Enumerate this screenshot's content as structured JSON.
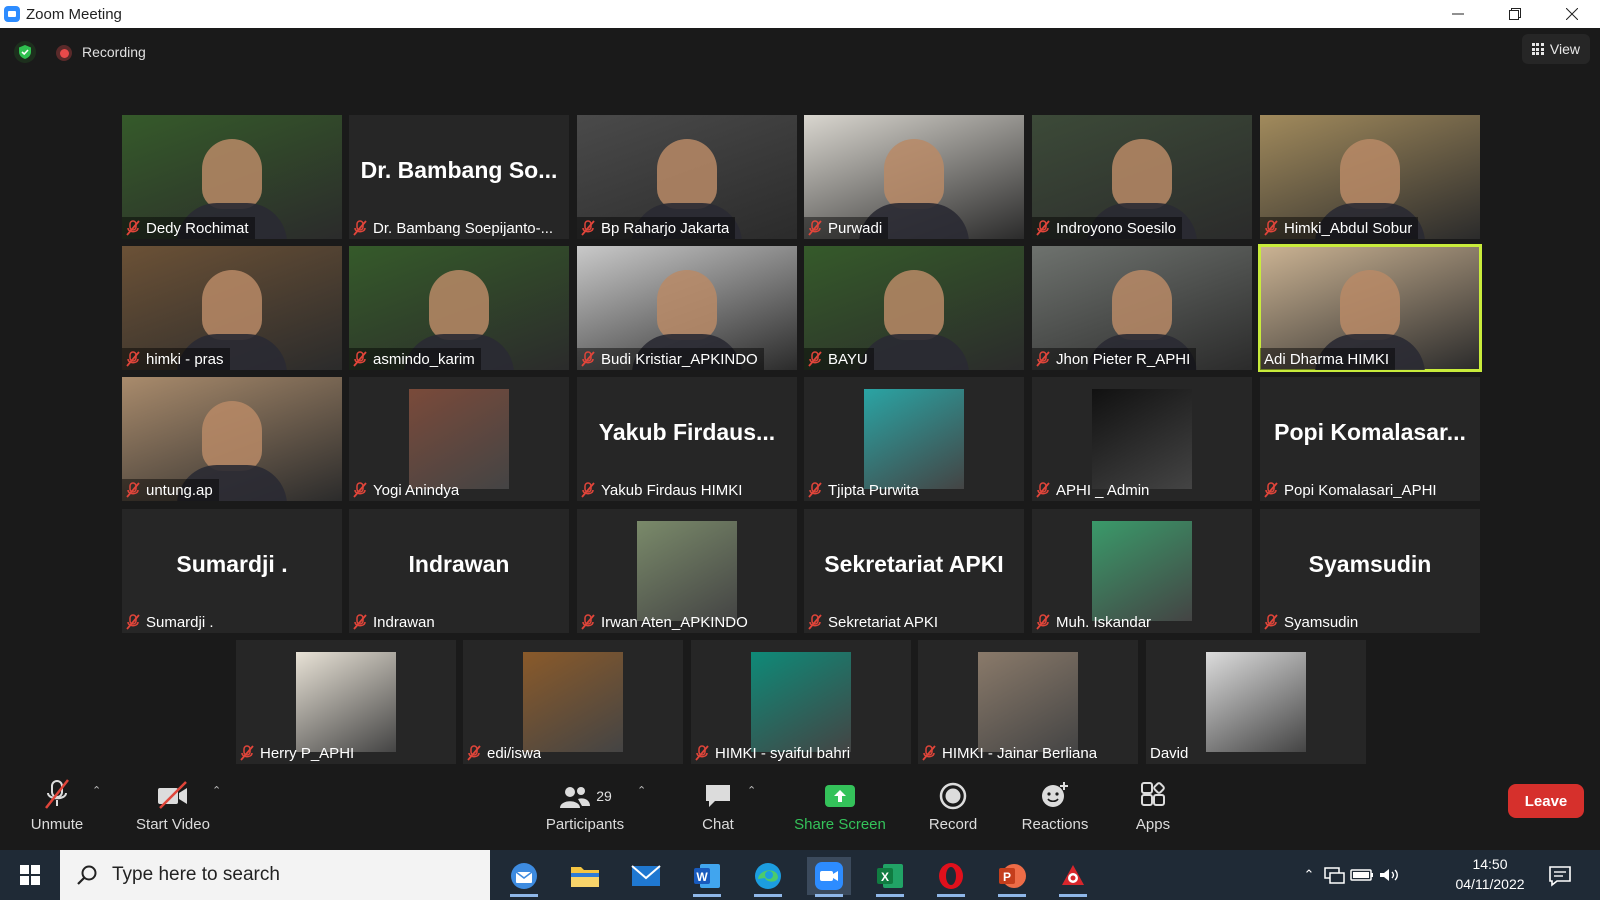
{
  "window": {
    "title": "Zoom Meeting"
  },
  "top_bar": {
    "recording_label": "Recording",
    "view_label": "View"
  },
  "gallery": {
    "tiles": [
      {
        "name": "Dedy Rochimat",
        "kind": "video",
        "bg": "#355a2a"
      },
      {
        "name": "Dr. Bambang Soepijanto-...",
        "kind": "text",
        "big": "Dr. Bambang So..."
      },
      {
        "name": "Bp Raharjo Jakarta",
        "kind": "video",
        "bg": "#4a4a4a"
      },
      {
        "name": "Purwadi",
        "kind": "video",
        "bg": "#d9d6cf"
      },
      {
        "name": "Indroyono Soesilo",
        "kind": "video",
        "bg": "#3c4a38"
      },
      {
        "name": "Himki_Abdul Sobur",
        "kind": "video",
        "bg": "#a18a5c"
      },
      {
        "name": "himki - pras",
        "kind": "video",
        "bg": "#6b5136"
      },
      {
        "name": "asmindo_karim",
        "kind": "video",
        "bg": "#355a2a"
      },
      {
        "name": "Budi Kristiar_APKINDO",
        "kind": "video",
        "bg": "#c9c9c9"
      },
      {
        "name": "BAYU",
        "kind": "video",
        "bg": "#355a2a"
      },
      {
        "name": "Jhon Pieter R_APHI",
        "kind": "video",
        "bg": "#6e726e"
      },
      {
        "name": "Adi Dharma HIMKI",
        "kind": "video",
        "bg": "#cbb393",
        "active": true,
        "muted": false
      },
      {
        "name": "untung.ap",
        "kind": "video",
        "bg": "#a98b6c"
      },
      {
        "name": "Yogi Anindya",
        "kind": "pic",
        "bg": "#7a4a3a"
      },
      {
        "name": "Yakub Firdaus HIMKI",
        "kind": "text",
        "big": "Yakub  Firdaus..."
      },
      {
        "name": "Tjipta Purwita",
        "kind": "pic",
        "bg": "#2aa4a4"
      },
      {
        "name": "APHI _ Admin",
        "kind": "pic",
        "bg": "#111111"
      },
      {
        "name": "Popi Komalasari_APHI",
        "kind": "text",
        "big": "Popi  Komalasar..."
      },
      {
        "name": "Sumardji .",
        "kind": "text",
        "big": "Sumardji ."
      },
      {
        "name": "Indrawan",
        "kind": "text",
        "big": "Indrawan"
      },
      {
        "name": "Irwan Aten_APKINDO",
        "kind": "pic",
        "bg": "#7a8a6a"
      },
      {
        "name": "Sekretariat APKI",
        "kind": "text",
        "big": "Sekretariat APKI"
      },
      {
        "name": "Muh. Iskandar",
        "kind": "pic",
        "bg": "#3a9a6a"
      },
      {
        "name": "Syamsudin",
        "kind": "text",
        "big": "Syamsudin"
      },
      {
        "name": "Herry P_APHI",
        "kind": "pic",
        "bg": "#e8e2d6"
      },
      {
        "name": "edi/iswa",
        "kind": "pic",
        "bg": "#8a5a2a"
      },
      {
        "name": "HIMKI - syaiful bahri",
        "kind": "pic",
        "bg": "#0e8a78"
      },
      {
        "name": "HIMKI - Jainar Berliana",
        "kind": "pic",
        "bg": "#8a7a6a"
      },
      {
        "name": "David",
        "kind": "pic",
        "bg": "#dcdcdc",
        "muted": false
      }
    ]
  },
  "controls": {
    "unmute": "Unmute",
    "start_video": "Start Video",
    "participants": "Participants",
    "participants_count": "29",
    "chat": "Chat",
    "share_screen": "Share Screen",
    "record": "Record",
    "reactions": "Reactions",
    "apps": "Apps",
    "leave": "Leave"
  },
  "taskbar": {
    "search_placeholder": "Type here to search",
    "time": "14:50",
    "date": "04/11/2022",
    "apps": [
      "thunderbird",
      "file-explorer",
      "mail",
      "word",
      "edge",
      "zoom",
      "excel",
      "opera",
      "powerpoint",
      "pdf-tool"
    ]
  },
  "colors": {
    "active_speaker": "#c9ec3b",
    "share_green": "#34c25a",
    "leave_red": "#d6302c",
    "muted_red": "#e0453a"
  }
}
